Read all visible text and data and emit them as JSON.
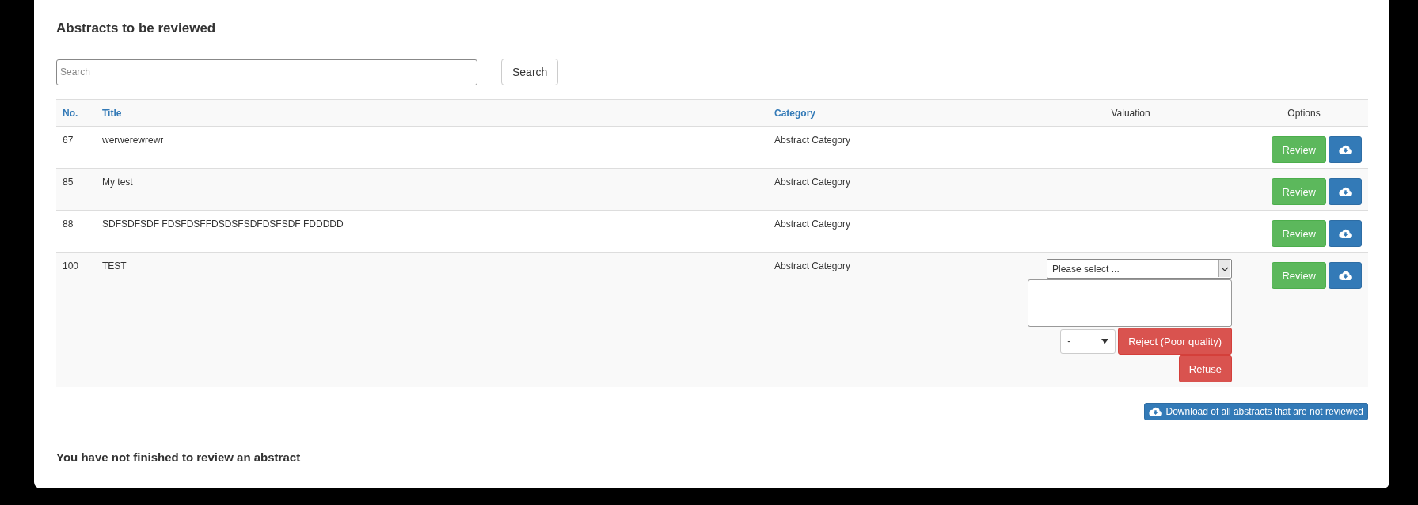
{
  "heading": "Abstracts to be reviewed",
  "search": {
    "placeholder": "Search",
    "button": "Search"
  },
  "table": {
    "columns": [
      {
        "label": "No.",
        "kind": "link"
      },
      {
        "label": "Title",
        "kind": "link"
      },
      {
        "label": "Category",
        "kind": "link"
      },
      {
        "label": "Valuation",
        "kind": "plain"
      },
      {
        "label": "Options",
        "kind": "plain"
      }
    ],
    "rows": [
      {
        "no": "67",
        "title": "werwerewrewr",
        "category": "Abstract Category",
        "review": "Review"
      },
      {
        "no": "85",
        "title": "My test",
        "category": "Abstract Category",
        "review": "Review"
      },
      {
        "no": "88",
        "title": "SDFSDFSDF FDSFDSFFDSDSFSDFDSFSDF FDDDDD",
        "category": "Abstract Category",
        "review": "Review"
      },
      {
        "no": "100",
        "title": "TEST",
        "category": "Abstract Category",
        "review": "Review",
        "valuation": {
          "select": "Please select ...",
          "grade": "-",
          "reject": "Reject (Poor quality)",
          "refuse": "Refuse"
        }
      }
    ]
  },
  "download_all": "Download of all abstracts that are not reviewed",
  "footer_message": "You have not finished to review an abstract"
}
